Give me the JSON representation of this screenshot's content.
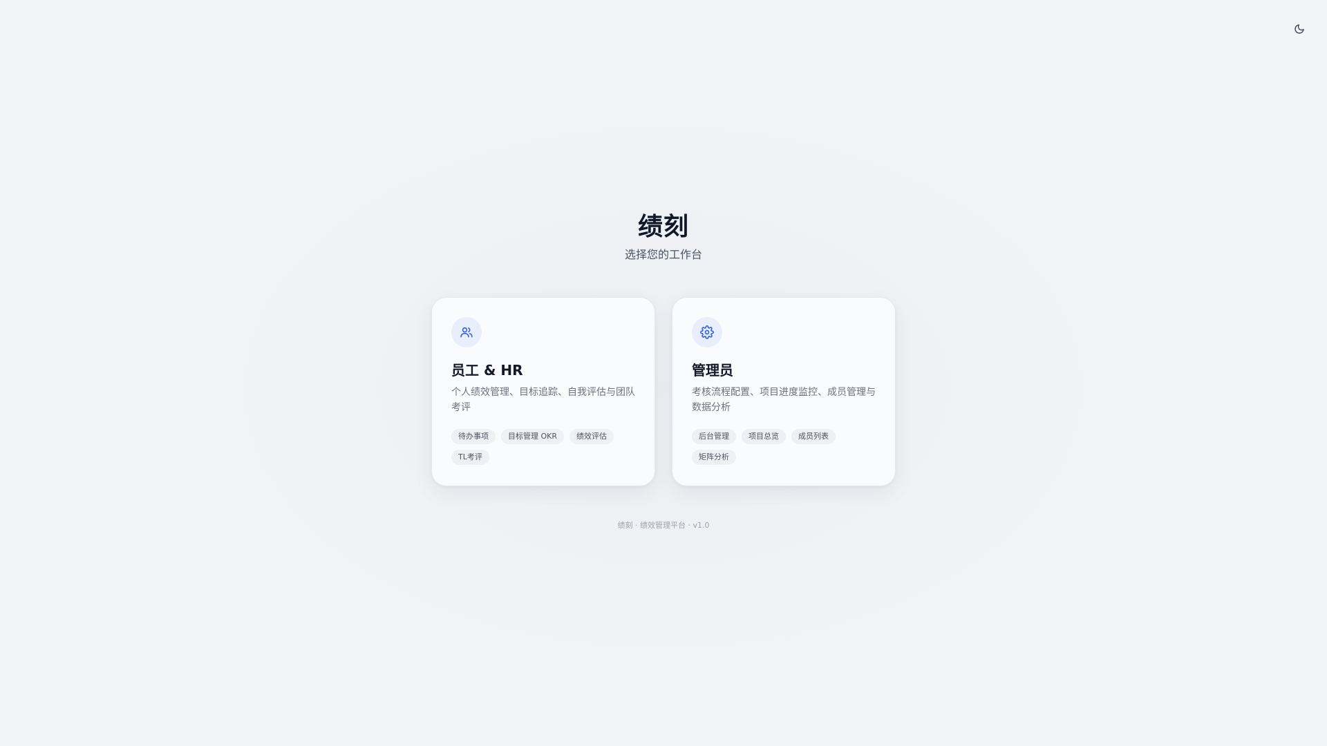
{
  "header": {
    "title": "绩刻",
    "subtitle": "选择您的工作台"
  },
  "theme_toggle": {
    "icon": "moon-icon"
  },
  "cards": [
    {
      "icon": "users-icon",
      "title": "员工 & HR",
      "description": "个人绩效管理、目标追踪、自我评估与团队考评",
      "tags": [
        "待办事项",
        "目标管理 OKR",
        "绩效评估",
        "TL考评"
      ]
    },
    {
      "icon": "gear-icon",
      "title": "管理员",
      "description": "考核流程配置、项目进度监控、成员管理与数据分析",
      "tags": [
        "后台管理",
        "项目总览",
        "成员列表",
        "矩阵分析"
      ]
    }
  ],
  "footer": {
    "text": "绩刻 · 绩效管理平台 · v1.0"
  },
  "colors": {
    "accent": "#3b66d6",
    "icon_bg": "#e8eefc",
    "tag_bg": "#eef0f3"
  }
}
